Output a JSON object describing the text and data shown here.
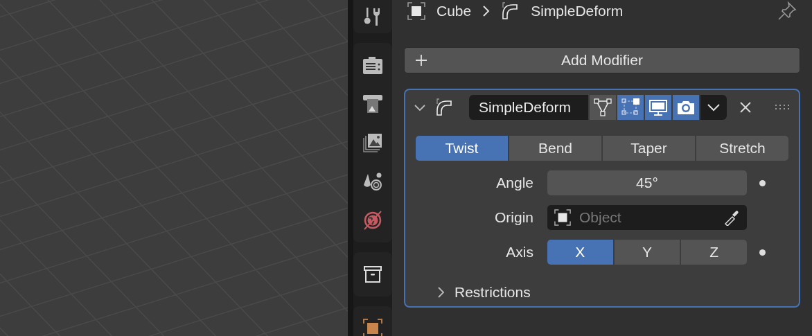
{
  "sidebar": {
    "tab_groups": [
      [
        {
          "kind": "tool"
        }
      ],
      [
        {
          "kind": "render"
        },
        {
          "kind": "output"
        },
        {
          "kind": "view-layer"
        },
        {
          "kind": "scene"
        },
        {
          "kind": "world"
        }
      ],
      [
        {
          "kind": "collection"
        }
      ],
      [
        {
          "kind": "object"
        }
      ]
    ]
  },
  "breadcrumb": {
    "object": "Cube",
    "modifier": "SimpleDeform"
  },
  "add_button": {
    "label": "Add Modifier"
  },
  "modifier": {
    "expanded": true,
    "name": "SimpleDeform",
    "toggles": [
      {
        "kind": "on-cage",
        "on": false
      },
      {
        "kind": "edit-mode",
        "on": true
      },
      {
        "kind": "viewport",
        "on": true
      },
      {
        "kind": "render",
        "on": true
      }
    ],
    "modes": [
      {
        "label": "Twist",
        "selected": true
      },
      {
        "label": "Bend",
        "selected": false
      },
      {
        "label": "Taper",
        "selected": false
      },
      {
        "label": "Stretch",
        "selected": false
      }
    ],
    "fields": [
      {
        "kind": "number",
        "label": "Angle",
        "value": "45°",
        "animatable": true
      },
      {
        "kind": "object",
        "label": "Origin",
        "placeholder": "Object",
        "animatable": false
      },
      {
        "kind": "axis",
        "label": "Axis",
        "options": [
          {
            "label": "X",
            "selected": true
          },
          {
            "label": "Y",
            "selected": false
          },
          {
            "label": "Z",
            "selected": false
          }
        ],
        "animatable": true
      }
    ],
    "subpanel": {
      "label": "Restrictions",
      "expanded": false
    }
  }
}
